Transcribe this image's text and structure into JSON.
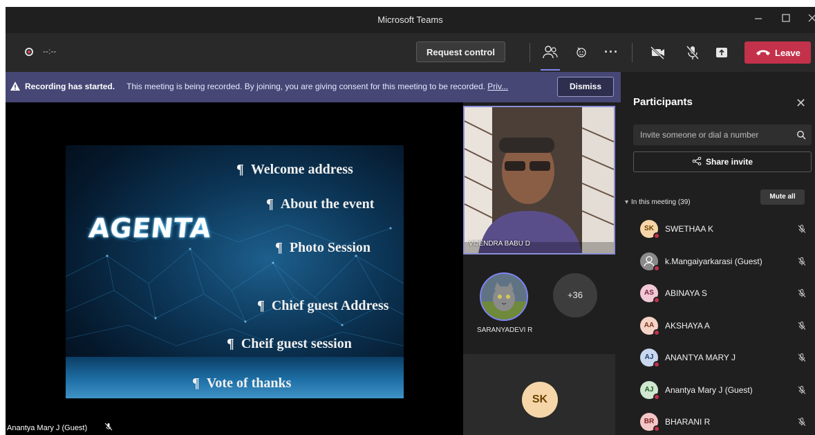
{
  "window": {
    "title": "Microsoft Teams"
  },
  "toolbar": {
    "timer": "--:--",
    "request_control_label": "Request control",
    "leave_label": "Leave"
  },
  "banner": {
    "bold": "Recording has started.",
    "message": "This meeting is being recorded. By joining, you are giving consent for this meeting to be recorded.",
    "link": "Priv...",
    "dismiss_label": "Dismiss"
  },
  "stage": {
    "slide": {
      "heading": "AGENTA",
      "bullet_glyph": "¶",
      "items": [
        "Welcome address",
        "About the event",
        "Photo Session",
        "Chief guest Address",
        "Cheif guest session",
        "Vote of thanks"
      ]
    },
    "speaker_name": "Anantya Mary J (Guest)"
  },
  "tiles": {
    "video_name": "VIJENDRA BABU D",
    "saranya_name": "SARANYADEVI R",
    "overflow_count": "+36",
    "sk_initials": "SK"
  },
  "panel": {
    "title": "Participants",
    "invite_placeholder": "Invite someone or dial a number",
    "share_invite_label": "Share invite",
    "section_label": "In this meeting (39)",
    "mute_all_label": "Mute all",
    "participants": [
      {
        "initials": "SK",
        "name": "SWETHAA K",
        "avatar_bg": "#f6d6a8",
        "avatar_fg": "#6b4100"
      },
      {
        "initials": "",
        "name": "k.Mangaiyarkarasi (Guest)",
        "avatar_bg": "#8a8a8a",
        "avatar_fg": "#ffffff"
      },
      {
        "initials": "AS",
        "name": "ABINAYA S",
        "avatar_bg": "#f1c8d6",
        "avatar_fg": "#7a1f3d"
      },
      {
        "initials": "AA",
        "name": "AKSHAYA A",
        "avatar_bg": "#f5d3c6",
        "avatar_fg": "#7a3318"
      },
      {
        "initials": "AJ",
        "name": "ANANTYA MARY J",
        "avatar_bg": "#c9d8ef",
        "avatar_fg": "#1f3d6b"
      },
      {
        "initials": "AJ",
        "name": "Anantya Mary J (Guest)",
        "avatar_bg": "#cfe8cf",
        "avatar_fg": "#1e5b1e"
      },
      {
        "initials": "BR",
        "name": "BHARANI R",
        "avatar_bg": "#f4c6c6",
        "avatar_fg": "#7a1f1f"
      }
    ]
  },
  "colors": {
    "accent": "#7f85f5",
    "leave": "#c4314b",
    "banner": "#464775"
  }
}
